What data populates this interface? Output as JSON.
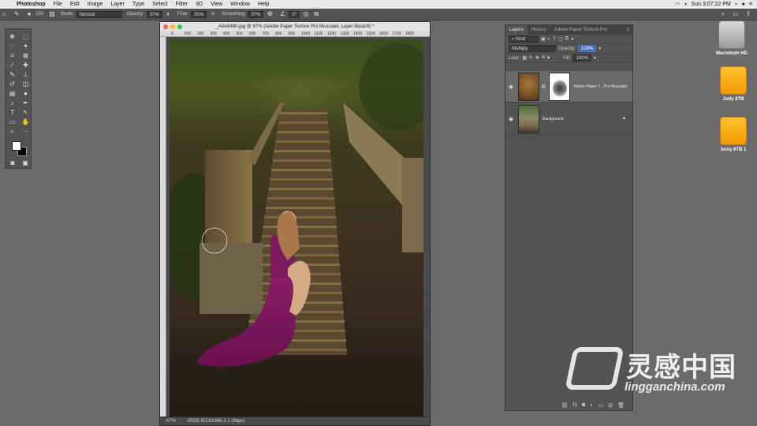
{
  "menubar": {
    "apple_icon": "apple-icon",
    "app_name": "Photoshop",
    "items": [
      "File",
      "Edit",
      "Image",
      "Layer",
      "Type",
      "Select",
      "Filter",
      "3D",
      "View",
      "Window",
      "Help"
    ],
    "clock": "Sun 3:07:22 PM"
  },
  "options_bar": {
    "brush_size": "150",
    "mode_label": "Mode:",
    "mode_value": "Normal",
    "opacity_label": "Opacity:",
    "opacity_value": "37%",
    "flow_label": "Flow:",
    "flow_value": "35%",
    "smoothing_label": "Smoothing:",
    "smoothing_value": "37%",
    "angle_value": "0°"
  },
  "document": {
    "title": "_A4A8490.jpg @ 67% (Adobe Paper Texture Pro Muscatel, Layer Mask/8) *",
    "ruler_ticks": [
      "0",
      "100",
      "200",
      "300",
      "400",
      "500",
      "600",
      "700",
      "800",
      "900",
      "1000",
      "1100",
      "1200",
      "1300",
      "1400",
      "1500",
      "1600",
      "1700",
      "1800"
    ],
    "zoom": "67%",
    "color_profile": "sRGB IEC61966-2.1 (8bpc)"
  },
  "layers_panel": {
    "tabs": [
      "Layers",
      "History",
      "Adobe Paper Texture Pro"
    ],
    "filter_kind": "Kind",
    "blend_mode": "Multiply",
    "opacity_label": "Opacity:",
    "opacity_value": "100%",
    "lock_label": "Lock:",
    "fill_label": "Fill:",
    "fill_value": "100%",
    "layers": [
      {
        "name": "Adobe Paper T... Pro Muscatel"
      },
      {
        "name": "Background"
      }
    ]
  },
  "desktop": {
    "drives": [
      "Macintosh HD",
      "Judy 8TB",
      "Sony 6TB 1"
    ]
  },
  "watermark": {
    "brand_cn": "灵感中国",
    "url": "lingganchina.com"
  },
  "colors": {
    "accent": "#4a6fb5",
    "panel_bg": "#535353",
    "desktop_bg": "#6b6b6b"
  }
}
